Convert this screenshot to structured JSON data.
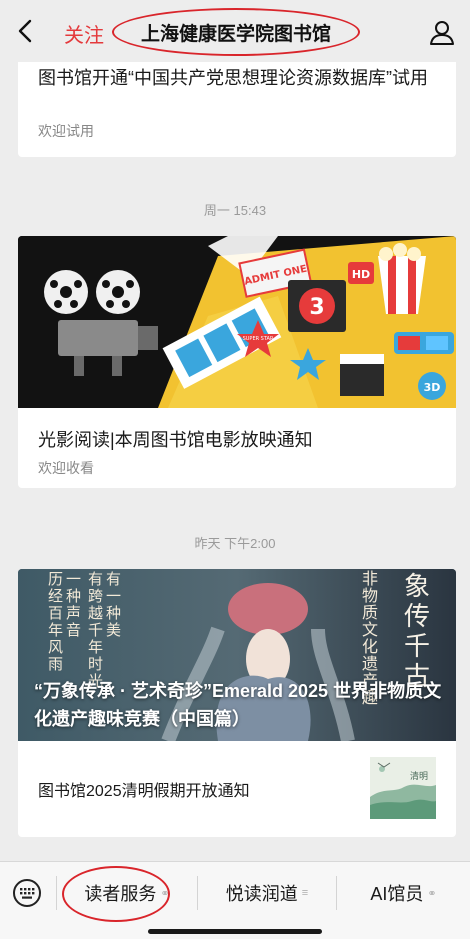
{
  "header": {
    "follow_label": "关注",
    "title": "上海健康医学院图书馆"
  },
  "feed": {
    "article1": {
      "title": "图书馆开通“中国共产党思想理论资源数据库”试用",
      "subtitle": "欢迎试用"
    },
    "time2": "周一 15:43",
    "article2": {
      "title": "光影阅读|本周图书馆电影放映通知",
      "subtitle": "欢迎收看",
      "cover": {
        "ticket": "ADMIT ONE",
        "count": "3",
        "tag_hd": "HD",
        "tag_3d": "3D",
        "tag_sp": "SUPER STAR"
      }
    },
    "time3": "昨天 下午2:00",
    "article3": {
      "cover_title": "“万象传承 · 艺术奇珍”Emerald 2025 世界非物质文化遗产趣味竞赛（中国篇）",
      "cover_columns": [
        "有跨越千年时光",
        "有一种美",
        "历经百年风雨",
        "一种声音"
      ],
      "cover_right_column": "非物质文化遗产趣",
      "cover_calligraphy": "象传千古",
      "sub_title": "图书馆2025清明假期开放通知",
      "thumb_label": "清明"
    }
  },
  "menu": {
    "items": [
      {
        "label": "读者服务",
        "link_icon": "⚭"
      },
      {
        "label": "悦读润道",
        "link_icon": "≡"
      },
      {
        "label": "AI馆员",
        "link_icon": "⚭"
      }
    ]
  },
  "colors": {
    "accent_red": "#e4393c",
    "annotation_red": "#d9252b",
    "page_bg": "#ededed"
  }
}
